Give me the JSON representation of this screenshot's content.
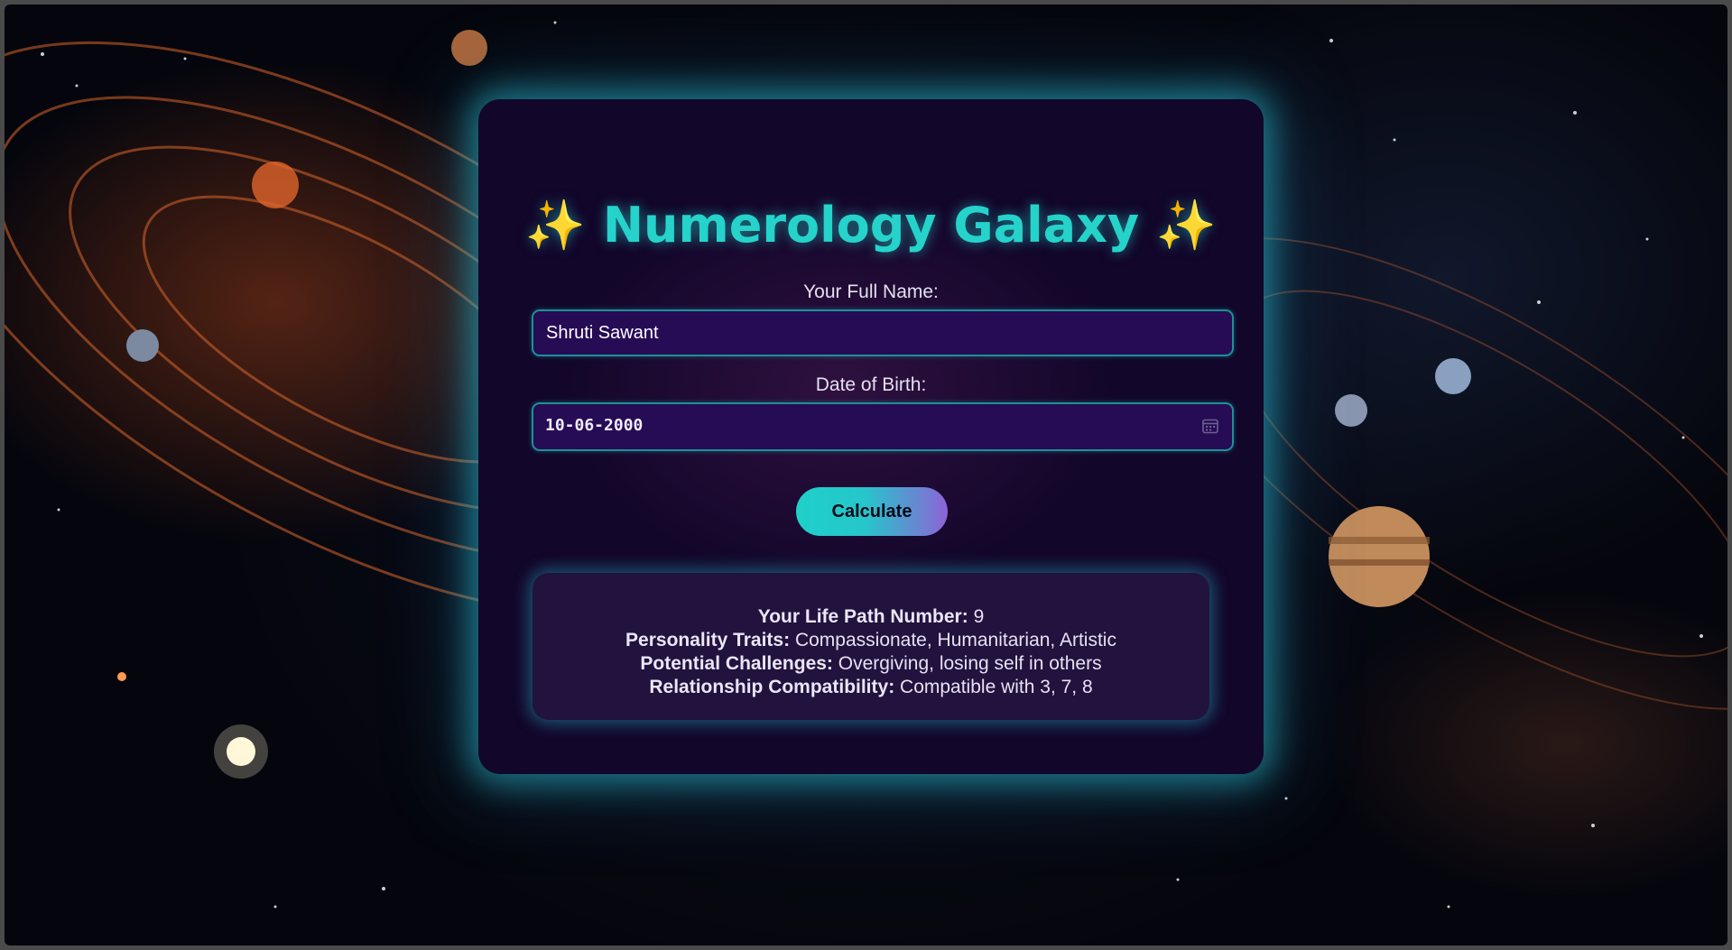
{
  "app": {
    "title": "✨ Numerology Galaxy ✨"
  },
  "form": {
    "name_label": "Your Full Name:",
    "name_value": "Shruti Sawant",
    "dob_label": "Date of Birth:",
    "dob_value": "10-06-2000",
    "calculate_label": "Calculate"
  },
  "result": {
    "life_path_label": "Your Life Path Number:",
    "life_path_value": "9",
    "traits_label": "Personality Traits:",
    "traits_value": "Compassionate, Humanitarian, Artistic",
    "challenges_label": "Potential Challenges:",
    "challenges_value": "Overgiving, losing self in others",
    "compat_label": "Relationship Compatibility:",
    "compat_value": "Compatible with 3, 7, 8"
  },
  "icons": {
    "date_picker": "calendar-icon"
  },
  "colors": {
    "title": "#25d3cb",
    "card_bg": "#12062a",
    "input_bg": "#260b55",
    "input_border": "#1e8f96",
    "button_start": "#1fd0c9",
    "button_end": "#8d63d6",
    "result_bg": "#22123e",
    "glow": "#28bed2"
  }
}
